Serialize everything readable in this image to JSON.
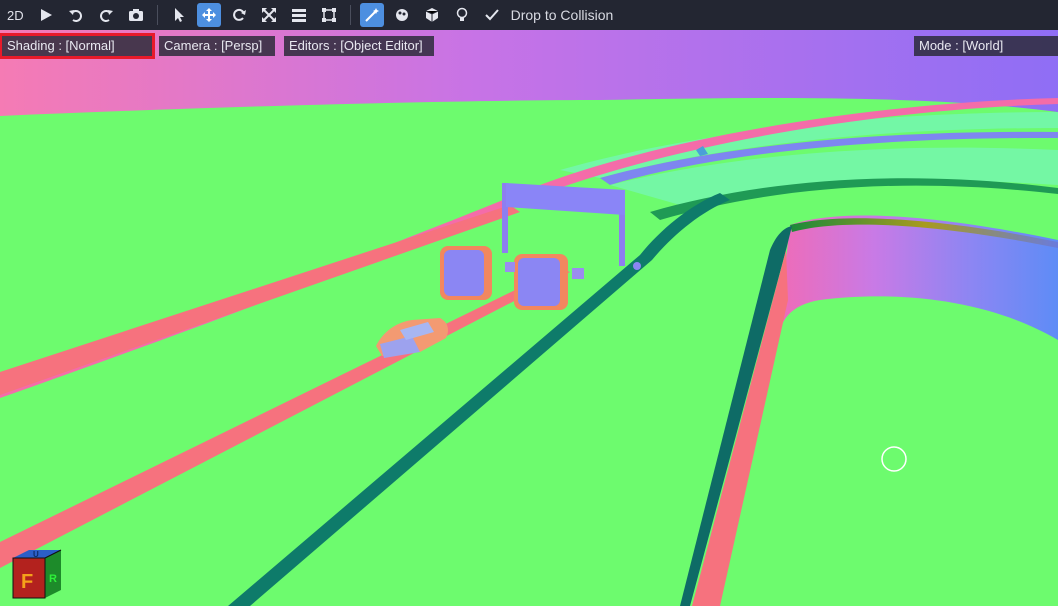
{
  "toolbar": {
    "mode_2d_label": "2D",
    "drop_to_collision_label": "Drop to Collision",
    "drop_to_collision_checked": true,
    "icons": [
      "play-icon",
      "undo-icon",
      "redo-icon",
      "camera-icon",
      "select-arrow-icon",
      "move-icon",
      "rotate-icon",
      "scale-icon",
      "list-icon",
      "bounding-box-icon",
      "magic-wand-icon",
      "paint-icon",
      "cube-icon",
      "light-bulb-icon",
      "check-icon"
    ],
    "active_tool": "move-icon"
  },
  "overlays": {
    "shading": "Shading : [Normal]",
    "camera": "Camera : [Persp]",
    "editors": "Editors : [Object Editor]",
    "mode": "Mode : [World]"
  },
  "gizmo": {
    "letters": [
      "F",
      "U",
      "R"
    ]
  },
  "colors": {
    "toolbar_bg": "#232632",
    "accent": "#4d8fe0",
    "selection_outline": "#e81a2a",
    "ground": "#6dfb6e"
  }
}
